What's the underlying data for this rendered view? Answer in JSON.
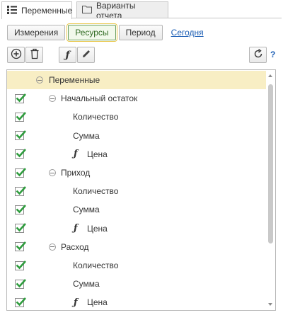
{
  "tabs": [
    {
      "label": "Переменные",
      "icon": "table-list-icon",
      "active": true
    },
    {
      "label": "Варианты отчета",
      "icon": "folder-icon",
      "active": false
    }
  ],
  "options": {
    "buttons": [
      "Измерения",
      "Ресурсы",
      "Период"
    ],
    "active": "Ресурсы",
    "link": "Сегодня"
  },
  "toolbar": {
    "add_icon": "add-circle-icon",
    "delete_icon": "trash-icon",
    "function_icon": "function-icon",
    "edit_icon": "pencil-icon",
    "refresh_icon": "refresh-icon",
    "help_label": "?"
  },
  "tree": {
    "root": "Переменные",
    "rows": [
      {
        "label": "Начальный остаток",
        "level": 1,
        "type": "group",
        "checked": true
      },
      {
        "label": "Количество",
        "level": 2,
        "type": "item",
        "checked": true
      },
      {
        "label": "Сумма",
        "level": 2,
        "type": "item",
        "checked": true
      },
      {
        "label": "Цена",
        "level": 2,
        "type": "function",
        "checked": true
      },
      {
        "label": "Приход",
        "level": 1,
        "type": "group",
        "checked": true
      },
      {
        "label": "Количество",
        "level": 2,
        "type": "item",
        "checked": true
      },
      {
        "label": "Сумма",
        "level": 2,
        "type": "item",
        "checked": true
      },
      {
        "label": "Цена",
        "level": 2,
        "type": "function",
        "checked": true
      },
      {
        "label": "Расход",
        "level": 1,
        "type": "group",
        "checked": true
      },
      {
        "label": "Количество",
        "level": 2,
        "type": "item",
        "checked": true
      },
      {
        "label": "Сумма",
        "level": 2,
        "type": "item",
        "checked": true
      },
      {
        "label": "Цена",
        "level": 2,
        "type": "function",
        "checked": true
      }
    ]
  },
  "colors": {
    "check": "#2e9c3d",
    "highlight": "#f8eec4",
    "link": "#1a5db4"
  }
}
